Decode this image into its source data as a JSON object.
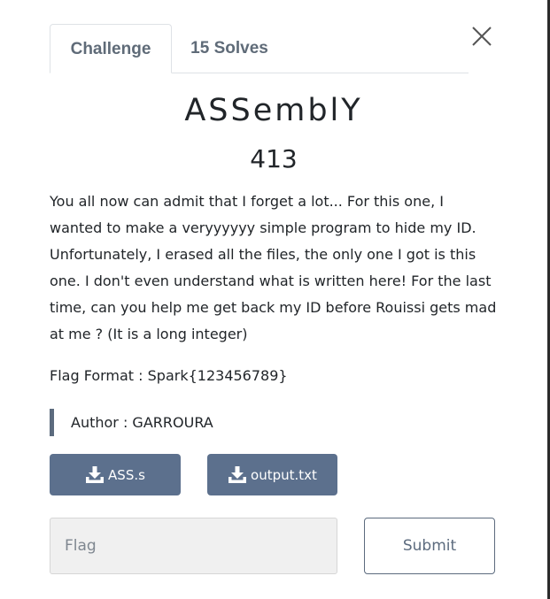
{
  "tabs": {
    "challenge_label": "Challenge",
    "solves_label": "15 Solves"
  },
  "close_icon": "close-icon",
  "challenge": {
    "name": "ASSemblY",
    "points": "413",
    "description": "You all now can admit that I forget a lot... For this one, I wanted to make a veryyyyyy simple program to hide my ID. Unfortunately, I erased all the files, the only one I got is this one. I don't even understand what is written here! For the last time, can you help me get back my ID before Rouissi gets mad at me ? (It is a long integer)",
    "flag_format": "Flag Format : Spark{123456789}",
    "author": "Author : GARROURA"
  },
  "files": [
    {
      "label": "ASS.s",
      "icon": "download-icon"
    },
    {
      "label": "output.txt",
      "icon": "download-icon"
    }
  ],
  "flag_form": {
    "placeholder": "Flag",
    "value": "",
    "submit_label": "Submit"
  },
  "colors": {
    "button_bg": "#5c708d",
    "tab_text": "#5f6b78",
    "author_bar": "#5c6b7e"
  }
}
